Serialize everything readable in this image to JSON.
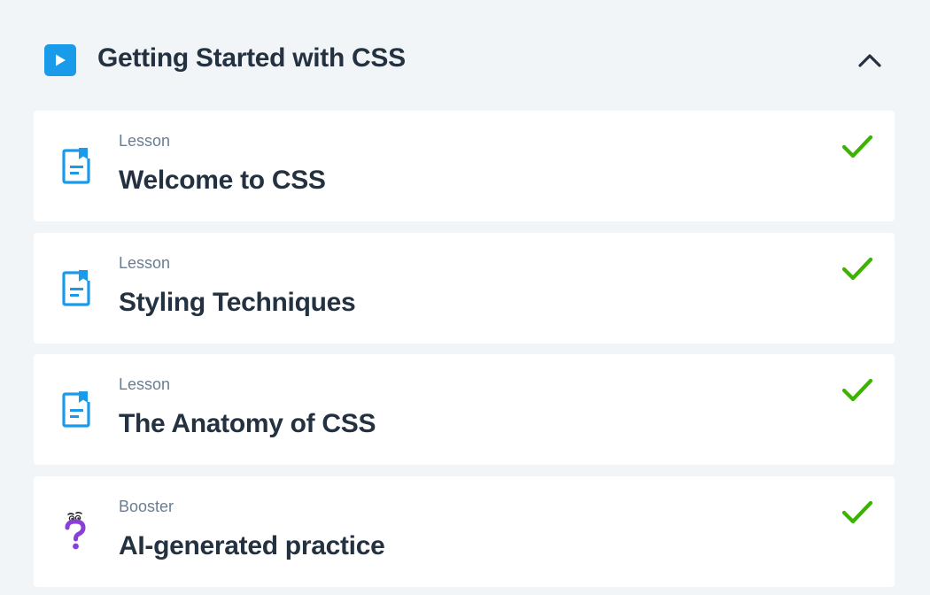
{
  "section": {
    "title": "Getting Started with CSS",
    "expanded": true
  },
  "colors": {
    "accent": "#1a9bea",
    "check": "#3bb300",
    "booster": "#8b3fd9",
    "background": "#f2f5f8",
    "text": "#243140",
    "muted": "#6b7d90"
  },
  "items": [
    {
      "type": "Lesson",
      "title": "Welcome to CSS",
      "icon": "lesson-document-icon",
      "completed": true
    },
    {
      "type": "Lesson",
      "title": "Styling Techniques",
      "icon": "lesson-document-icon",
      "completed": true
    },
    {
      "type": "Lesson",
      "title": "The Anatomy of CSS",
      "icon": "lesson-document-icon",
      "completed": true
    },
    {
      "type": "Booster",
      "title": "AI-generated practice",
      "icon": "booster-question-icon",
      "completed": true
    }
  ]
}
